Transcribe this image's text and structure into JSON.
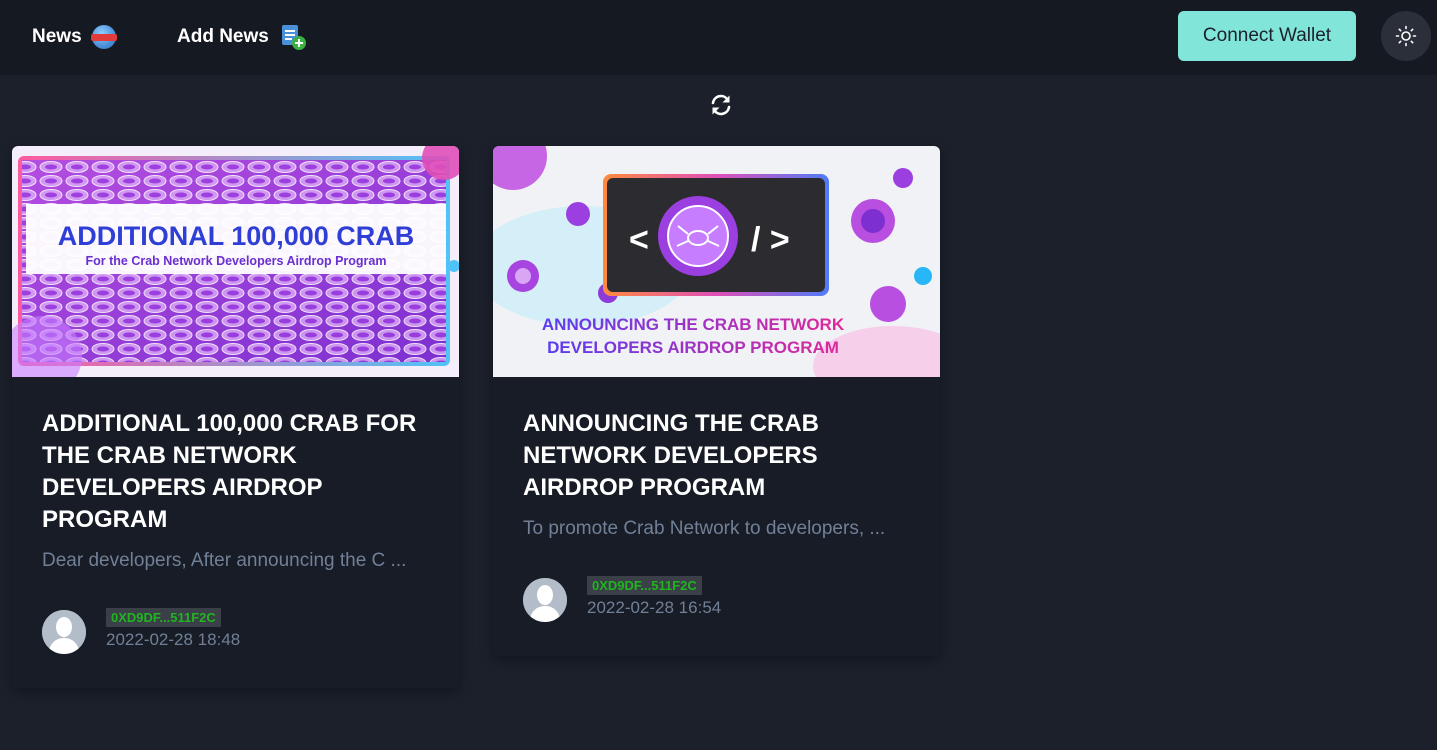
{
  "nav": {
    "news_label": "News",
    "news_icon": "news-globe-icon",
    "add_news_label": "Add News",
    "add_news_icon": "add-document-icon"
  },
  "header": {
    "connect_wallet_label": "Connect Wallet",
    "theme_icon": "sun-icon"
  },
  "toolbar": {
    "refresh_icon": "refresh-icon"
  },
  "colors": {
    "background": "#1b202b",
    "topbar": "#151922",
    "accent": "#81e6d9",
    "card": "#171c26",
    "muted_text": "#718096",
    "address_green": "#1fb51f"
  },
  "cards": [
    {
      "image": {
        "headline": "ADDITIONAL 100,000 CRAB",
        "subline": "For the Crab Network Developers Airdrop Program"
      },
      "title": "ADDITIONAL 100,000 CRAB FOR THE CRAB NETWORK DEVELOPERS AIRDROP PROGRAM",
      "description": "Dear developers, After announcing the C ...",
      "author_address": "0XD9DF...511F2C",
      "timestamp": "2022-02-28 18:48"
    },
    {
      "image": {
        "left_glyph": "<",
        "right_glyph": "/ >",
        "line1": "ANNOUNCING THE CRAB NETWORK",
        "line2": "DEVELOPERS AIRDROP PROGRAM"
      },
      "title": "ANNOUNCING THE CRAB NETWORK DEVELOPERS AIRDROP PROGRAM",
      "description": "To promote Crab Network to developers, ...",
      "author_address": "0XD9DF...511F2C",
      "timestamp": "2022-02-28 16:54"
    }
  ]
}
